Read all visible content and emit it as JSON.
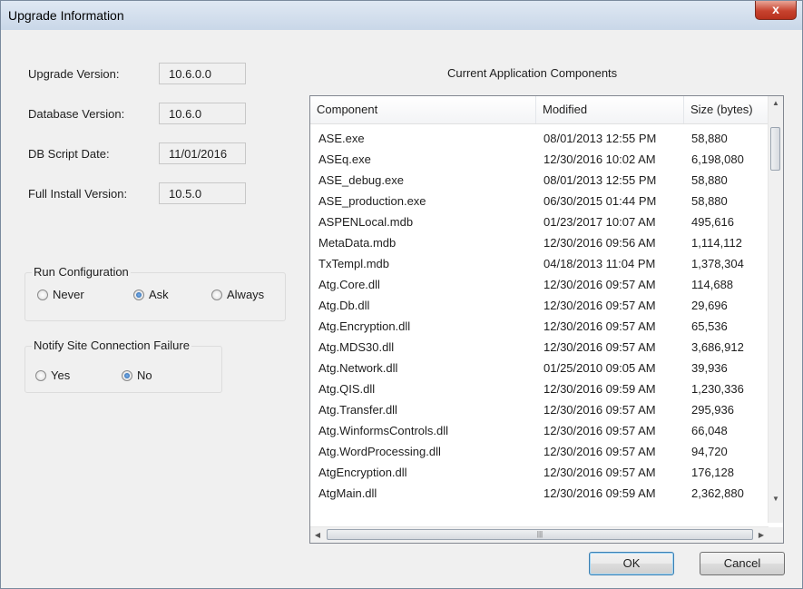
{
  "window": {
    "title": "Upgrade Information",
    "close_glyph": "x"
  },
  "fields": [
    {
      "label": "Upgrade Version:",
      "value": "10.6.0.0"
    },
    {
      "label": "Database Version:",
      "value": "10.6.0"
    },
    {
      "label": "DB Script Date:",
      "value": "11/01/2016"
    },
    {
      "label": "Full Install Version:",
      "value": "10.5.0"
    }
  ],
  "run_configuration": {
    "label": "Run Configuration",
    "options": [
      "Never",
      "Ask",
      "Always"
    ],
    "selected": "Ask"
  },
  "notify": {
    "label": "Notify Site Connection Failure",
    "options": [
      "Yes",
      "No"
    ],
    "selected": "No"
  },
  "components": {
    "caption": "Current Application Components",
    "columns": [
      "Component",
      "Modified",
      "Size (bytes)"
    ],
    "rows": [
      [
        "ASE.exe",
        "08/01/2013 12:55 PM",
        "58,880"
      ],
      [
        "ASEq.exe",
        "12/30/2016 10:02 AM",
        "6,198,080"
      ],
      [
        "ASE_debug.exe",
        "08/01/2013 12:55 PM",
        "58,880"
      ],
      [
        "ASE_production.exe",
        "06/30/2015 01:44 PM",
        "58,880"
      ],
      [
        "ASPENLocal.mdb",
        "01/23/2017 10:07 AM",
        "495,616"
      ],
      [
        "MetaData.mdb",
        "12/30/2016 09:56 AM",
        "1,114,112"
      ],
      [
        "TxTempl.mdb",
        "04/18/2013 11:04 PM",
        "1,378,304"
      ],
      [
        "Atg.Core.dll",
        "12/30/2016 09:57 AM",
        "114,688"
      ],
      [
        "Atg.Db.dll",
        "12/30/2016 09:57 AM",
        "29,696"
      ],
      [
        "Atg.Encryption.dll",
        "12/30/2016 09:57 AM",
        "65,536"
      ],
      [
        "Atg.MDS30.dll",
        "12/30/2016 09:57 AM",
        "3,686,912"
      ],
      [
        "Atg.Network.dll",
        "01/25/2010 09:05 AM",
        "39,936"
      ],
      [
        "Atg.QIS.dll",
        "12/30/2016 09:59 AM",
        "1,230,336"
      ],
      [
        "Atg.Transfer.dll",
        "12/30/2016 09:57 AM",
        "295,936"
      ],
      [
        "Atg.WinformsControls.dll",
        "12/30/2016 09:57 AM",
        "66,048"
      ],
      [
        "Atg.WordProcessing.dll",
        "12/30/2016 09:57 AM",
        "94,720"
      ],
      [
        "AtgEncryption.dll",
        "12/30/2016 09:57 AM",
        "176,128"
      ],
      [
        "AtgMain.dll",
        "12/30/2016 09:59 AM",
        "2,362,880"
      ]
    ]
  },
  "buttons": {
    "ok": "OK",
    "cancel": "Cancel"
  },
  "icons": {
    "close": "close-icon",
    "scroll_up": "chevron-up-icon",
    "scroll_down": "chevron-down-icon",
    "scroll_left": "chevron-left-icon",
    "scroll_right": "chevron-right-icon"
  },
  "colors": {
    "title_bar": "#c9d7e8",
    "close_button": "#c7432f",
    "radio_selected": "#1f5fa8"
  }
}
